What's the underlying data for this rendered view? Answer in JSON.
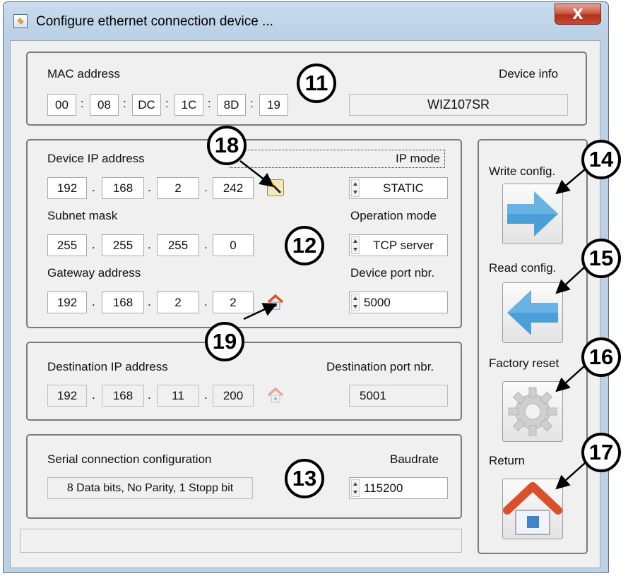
{
  "window": {
    "title": "Configure ethernet connection device ...",
    "close_label": "X"
  },
  "mac": {
    "label": "MAC address",
    "octets": [
      "00",
      "08",
      "DC",
      "1C",
      "8D",
      "19"
    ],
    "separator": ":",
    "device_info_label": "Device info",
    "device_info_value": "WIZ107SR"
  },
  "device": {
    "ip_label": "Device IP address",
    "ip": [
      "192",
      "168",
      "2",
      "242"
    ],
    "ip_mode_label": "IP mode",
    "ip_mode_value": "STATIC",
    "subnet_label": "Subnet mask",
    "subnet": [
      "255",
      "255",
      "255",
      "0"
    ],
    "operation_mode_label": "Operation mode",
    "operation_mode_value": "TCP server",
    "gateway_label": "Gateway address",
    "gateway": [
      "192",
      "168",
      "2",
      "2"
    ],
    "port_label": "Device port nbr.",
    "port_value": "5000",
    "dot": "."
  },
  "destination": {
    "ip_label": "Destination IP address",
    "ip": [
      "192",
      "168",
      "11",
      "200"
    ],
    "port_label": "Destination port nbr.",
    "port_value": "5001"
  },
  "serial": {
    "label": "Serial connection configuration",
    "value": "8 Data bits, No Parity, 1 Stopp bit",
    "baudrate_label": "Baudrate",
    "baudrate_value": "115200"
  },
  "actions": {
    "write_label": "Write config.",
    "read_label": "Read config.",
    "reset_label": "Factory reset",
    "return_label": "Return"
  },
  "callouts": [
    "11",
    "12",
    "13",
    "14",
    "15",
    "16",
    "17",
    "18",
    "19"
  ],
  "icons": {
    "write": "arrow-right-icon",
    "read": "arrow-left-icon",
    "reset": "gear-icon",
    "return": "home-icon",
    "ip_tool": "wand-icon",
    "gateway_tool": "home-icon"
  },
  "colors": {
    "arrow_blue": "#4a9fd8",
    "home_roof": "#d9502c",
    "title_gradient": "#c9dbed",
    "close_red": "#c74a30"
  }
}
